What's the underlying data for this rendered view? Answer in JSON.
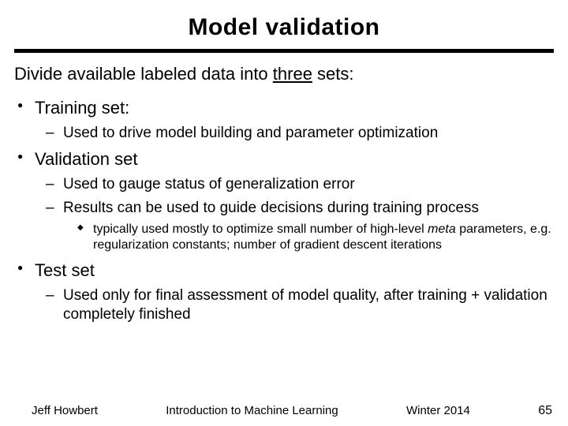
{
  "title": "Model validation",
  "intro_pre": "Divide available labeled data into ",
  "intro_underlined": "three",
  "intro_post": " sets:",
  "sections": {
    "training": {
      "heading": "Training set:",
      "sub1": "Used to drive model building and parameter optimization"
    },
    "validation": {
      "heading": "Validation set",
      "sub1": "Used to gauge status of generalization error",
      "sub2": "Results can be used to guide decisions during training process",
      "subsub_pre": "typically used mostly to optimize small number of high-level ",
      "subsub_ital": "meta",
      "subsub_post": " parameters, e.g. regularization constants; number of gradient descent iterations"
    },
    "test": {
      "heading": "Test set",
      "sub1": "Used only for final assessment of model quality, after training + validation completely finished"
    }
  },
  "footer": {
    "author": "Jeff Howbert",
    "course": "Introduction to Machine Learning",
    "term": "Winter 2014",
    "page": "65"
  }
}
